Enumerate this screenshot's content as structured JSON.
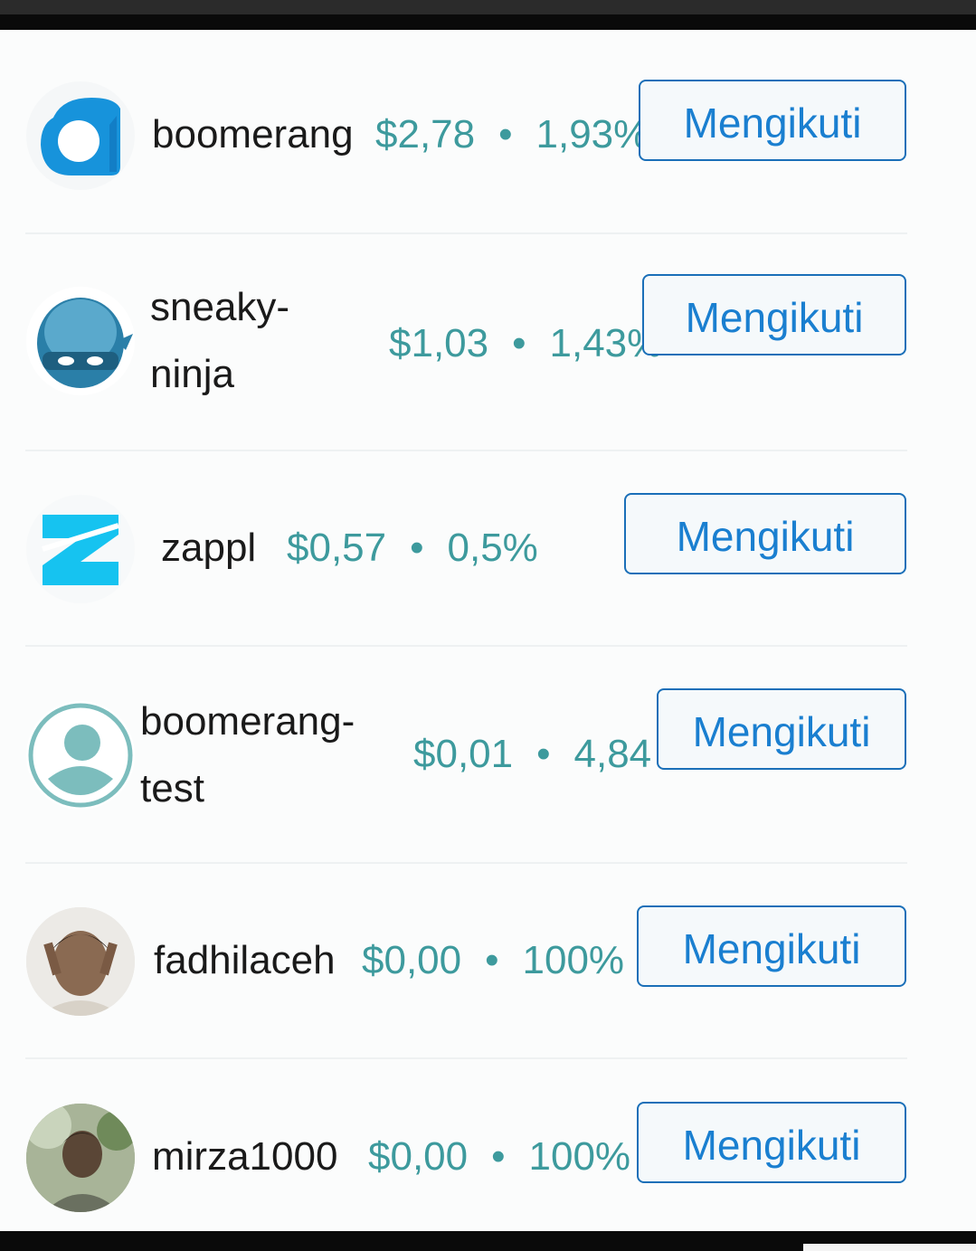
{
  "users": [
    {
      "name_lines": [
        "boomerang"
      ],
      "value": "$2,78",
      "percent": "1,93%",
      "button": "Mengikuti",
      "avatar": "boomerang-logo-icon"
    },
    {
      "name_lines": [
        "sneaky-",
        "ninja"
      ],
      "value": "$1,03",
      "percent": "1,43%",
      "button": "Mengikuti",
      "avatar": "ninja-avatar"
    },
    {
      "name_lines": [
        "zappl"
      ],
      "value": "$0,57",
      "percent": "0,5%",
      "button": "Mengikuti",
      "avatar": "zappl-logo-icon"
    },
    {
      "name_lines": [
        "boomerang-",
        "test"
      ],
      "value": "$0,01",
      "percent": "4,84",
      "button": "Mengikuti",
      "avatar": "default-user-icon"
    },
    {
      "name_lines": [
        "fadhilaceh"
      ],
      "value": "$0,00",
      "percent": "100%",
      "button": "Mengikuti",
      "avatar": "photo-avatar"
    },
    {
      "name_lines": [
        "mirza1000"
      ],
      "value": "$0,00",
      "percent": "100%",
      "button": "Mengikuti",
      "avatar": "photo-avatar"
    }
  ],
  "dot": "•",
  "colors": {
    "accent": "#1a7fd0",
    "meta": "#3d9a9d",
    "button_border": "#1a6fb8"
  }
}
